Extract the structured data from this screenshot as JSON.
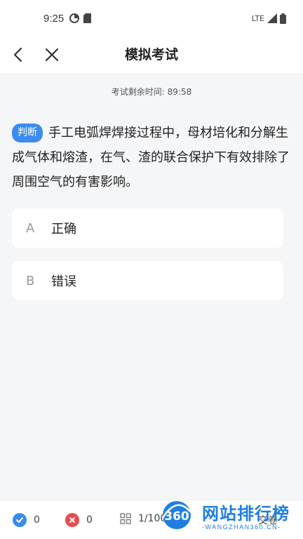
{
  "status_bar": {
    "time": "9:25",
    "network": "LTE"
  },
  "nav": {
    "title": "模拟考试"
  },
  "timer": {
    "label": "考试剩余时间:",
    "value": "89:58"
  },
  "question": {
    "type_label": "判断",
    "text": "手工电弧焊焊接过程中，母材培化和分解生成气体和熔渣，在气、渣的联合保护下有效排除了周围空气的有害影响。"
  },
  "options": [
    {
      "letter": "A",
      "text": "正确"
    },
    {
      "letter": "B",
      "text": "错误"
    }
  ],
  "bottom_bar": {
    "correct_count": "0",
    "wrong_count": "0",
    "progress": "1/100",
    "submit_label": "交卷"
  },
  "watermark": {
    "badge": "360",
    "title": "网站排行榜",
    "subtitle": "-WANGZHAN360.CN-"
  },
  "colors": {
    "accent": "#3c8cf0",
    "correct": "#3c8cf0",
    "wrong": "#e84b4b"
  }
}
